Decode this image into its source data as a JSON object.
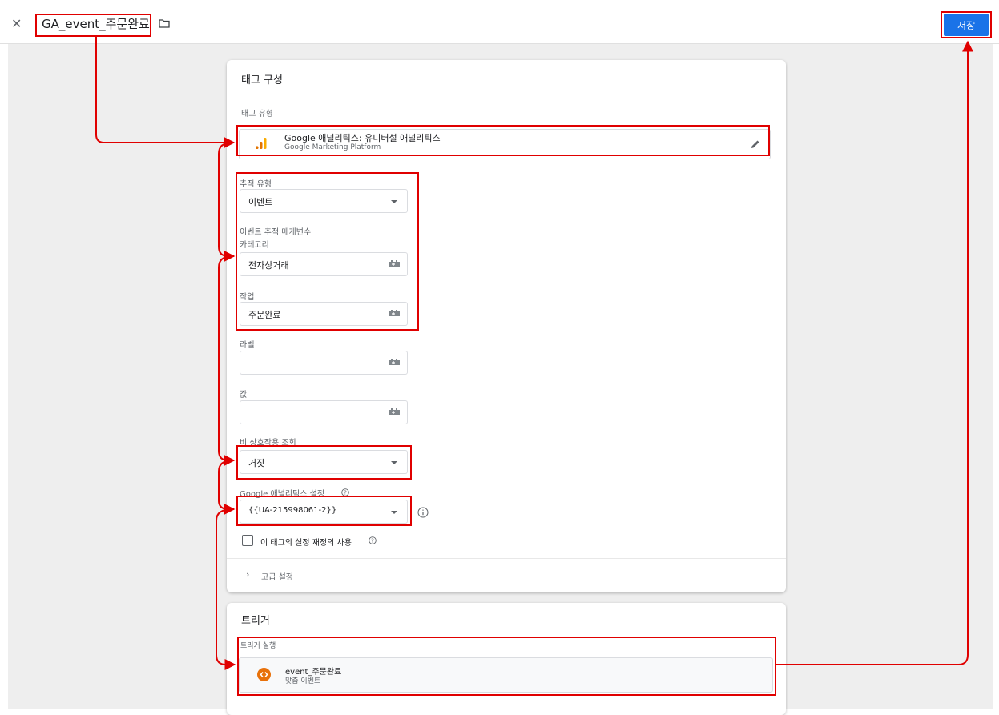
{
  "header": {
    "tag_name": "GA_event_주문완료",
    "save_label": "저장"
  },
  "tag_config": {
    "title": "태그 구성",
    "tag_type_label": "태그 유형",
    "tag_type": {
      "title": "Google 애널리틱스: 유니버설 애널리틱스",
      "subtitle": "Google Marketing Platform"
    },
    "tracking_type_label": "추적 유형",
    "tracking_type_value": "이벤트",
    "event_params_label": "이벤트 추적 매개변수",
    "category_label": "카테고리",
    "category_value": "전자상거래",
    "action_label": "작업",
    "action_value": "주문완료",
    "label_label": "라벨",
    "label_value": "",
    "value_label": "값",
    "value_value": "",
    "non_interaction_label": "비 상호작용 조회",
    "non_interaction_value": "거짓",
    "ga_settings_label": "Google 애널리틱스 설정",
    "ga_settings_value": "{{UA-215998061-2}}",
    "override_label": "이 태그의 설정 재정의 사용",
    "advanced_label": "고급 설정"
  },
  "triggering": {
    "title": "트리거",
    "firing_label": "트리거 실행",
    "trigger_name": "event_주문완료",
    "trigger_type": "맞춤 이벤트"
  },
  "colors": {
    "accent": "#1a73e8",
    "annotation": "#e00000",
    "ga_orange": "#f9ab00",
    "trigger_orange": "#e8710a"
  }
}
